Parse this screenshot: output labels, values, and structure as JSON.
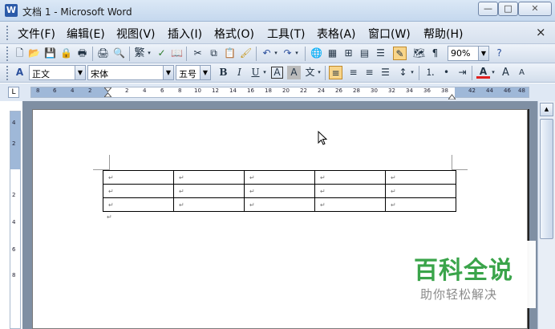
{
  "window": {
    "title": "文档 1 - Microsoft Word",
    "minimize_glyph": "—",
    "maximize_glyph": "□",
    "close_glyph": "✕"
  },
  "menu": {
    "items": [
      "文件(F)",
      "编辑(E)",
      "视图(V)",
      "插入(I)",
      "格式(O)",
      "工具(T)",
      "表格(A)",
      "窗口(W)",
      "帮助(H)"
    ],
    "close_glyph": "×"
  },
  "toolbar_standard": {
    "traditional_label": "繁",
    "zoom": "90%"
  },
  "toolbar_format": {
    "style": "正文",
    "font": "宋体",
    "size": "五号",
    "bold": "B",
    "italic": "I",
    "underline": "U",
    "char_border": "A",
    "char_shading": "A",
    "font_color": "A",
    "grow_font": "A",
    "shrink_font": "A"
  },
  "ruler": {
    "corner_glyph": "L",
    "h_numbers": [
      "8",
      "6",
      "4",
      "2",
      "2",
      "4",
      "6",
      "8",
      "10",
      "12",
      "14",
      "16",
      "18",
      "20",
      "22",
      "24",
      "26",
      "28",
      "30",
      "32",
      "34",
      "36",
      "38",
      "42",
      "44",
      "46",
      "48"
    ],
    "v_numbers": [
      "4",
      "2",
      "2",
      "4",
      "6",
      "8"
    ]
  },
  "document": {
    "table": {
      "rows": 3,
      "cols": 5,
      "cell_mark": "↵"
    },
    "para_mark": "↵"
  },
  "watermark": {
    "main": "百科全说",
    "sub": "助你轻松解决"
  },
  "colors": {
    "accent_green": "#3aa44a",
    "page_bg": "#ffffff",
    "doc_bg": "#7f8fa3",
    "font_color_bar": "#e02020"
  }
}
